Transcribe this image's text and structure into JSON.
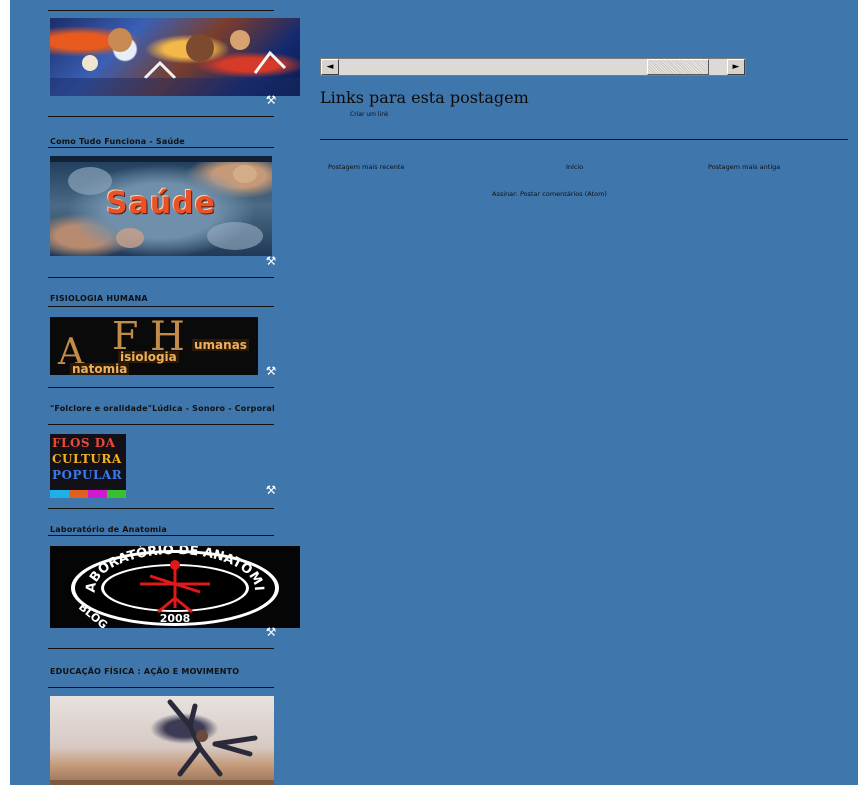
{
  "sidebar": {
    "widgets": [
      {
        "title": "",
        "image_alt": "sports collage"
      },
      {
        "title": "Como Tudo Funciona - Saúde",
        "image_text": "Saúde"
      },
      {
        "title": "FISIOLOGIA HUMANA",
        "image_text": {
          "a": "A",
          "f": "F",
          "h": "H",
          "line1": "umanas",
          "line2": "isiologia",
          "line3": "natomia"
        }
      },
      {
        "title": "\"Folclore e oralidade\"Lúdica - Sonoro - Corporal",
        "image_text": {
          "l1": "FLOS DA",
          "l2": "CULTURA",
          "l3": "POPULAR"
        }
      },
      {
        "title": "Laboratório de Anatomia",
        "image_text": {
          "ring_top": "LABORATÓRIO DE ANATOMIA",
          "ring_left": "BLOG",
          "year": "2008"
        }
      },
      {
        "title": "EDUCAÇÃO FÍSICA : AÇÃO E MOVIMENTO"
      }
    ],
    "edit_icon": "wrench-screwdriver-icon"
  },
  "main": {
    "scrollbar": {
      "left_arrow": "◄",
      "right_arrow": "►"
    },
    "links_heading": "Links para esta postagem",
    "create_link": "Criar um link",
    "pager": {
      "newer": "Postagem mais recente",
      "home": "Início",
      "older": "Postagem mais antiga"
    },
    "subscribe": "Assinar: Postar comentários (Atom)"
  },
  "colors": {
    "background": "#3f76ac",
    "text": "#111111",
    "scrollbar": "#d6d3ce"
  }
}
